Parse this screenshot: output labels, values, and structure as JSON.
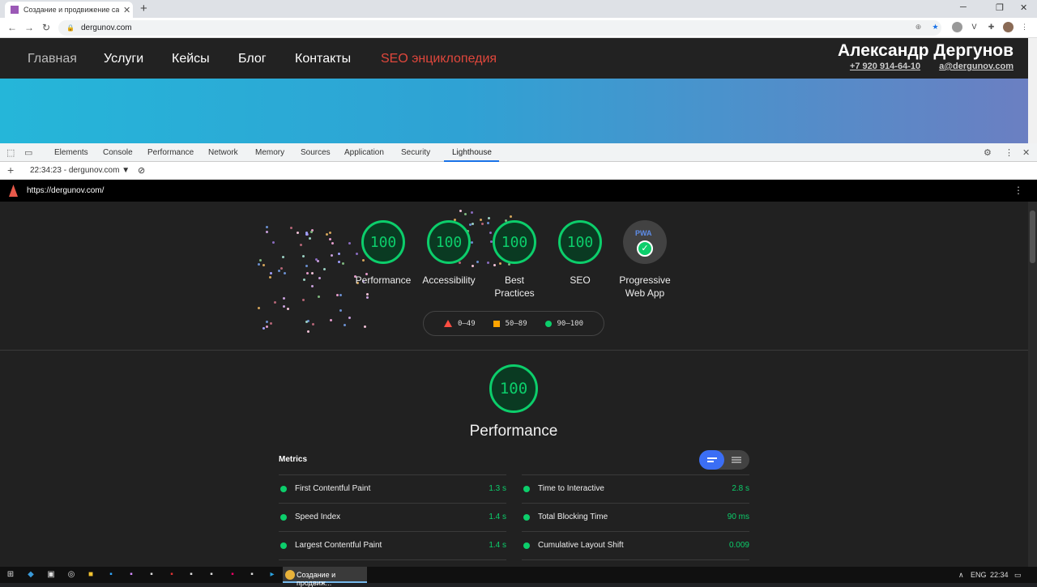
{
  "browser": {
    "tab_title": "Создание и продвижение сайтов",
    "url": "dergunov.com"
  },
  "site": {
    "nav": [
      "Главная",
      "Услуги",
      "Кейсы",
      "Блог",
      "Контакты",
      "SEO энциклопедия"
    ],
    "brand_name": "Александр Дергунов",
    "phone": "+7 920 914-64-10",
    "email": "a@dergunov.com"
  },
  "devtools": {
    "tabs": [
      "Elements",
      "Console",
      "Performance",
      "Network",
      "Memory",
      "Sources",
      "Application",
      "Security",
      "Lighthouse"
    ],
    "active_tab": "Lighthouse",
    "session": "22:34:23 - dergunov.com ▼"
  },
  "lighthouse": {
    "url": "https://dergunov.com/",
    "gauges": [
      {
        "score": "100",
        "label": "Performance"
      },
      {
        "score": "100",
        "label": "Accessibility"
      },
      {
        "score": "100",
        "label": "Best Practices"
      },
      {
        "score": "100",
        "label": "SEO"
      }
    ],
    "pwa": {
      "badge": "PWA",
      "label": "Progressive Web App"
    },
    "legend": {
      "fail": "0–49",
      "average": "50–89",
      "pass": "90–100"
    },
    "performance": {
      "score": "100",
      "title": "Performance",
      "metrics_heading": "Metrics",
      "metrics_left": [
        {
          "name": "First Contentful Paint",
          "value": "1.3 s"
        },
        {
          "name": "Speed Index",
          "value": "1.4 s"
        },
        {
          "name": "Largest Contentful Paint",
          "value": "1.4 s"
        }
      ],
      "metrics_right": [
        {
          "name": "Time to Interactive",
          "value": "2.8 s"
        },
        {
          "name": "Total Blocking Time",
          "value": "90 ms"
        },
        {
          "name": "Cumulative Layout Shift",
          "value": "0.009"
        }
      ]
    },
    "colors": {
      "pass": "#0cce6b",
      "average": "#ffa400",
      "fail": "#ff4e42"
    }
  },
  "taskbar": {
    "active_window": "Создание и продвиж...",
    "lang": "ENG",
    "time": "22:34"
  }
}
